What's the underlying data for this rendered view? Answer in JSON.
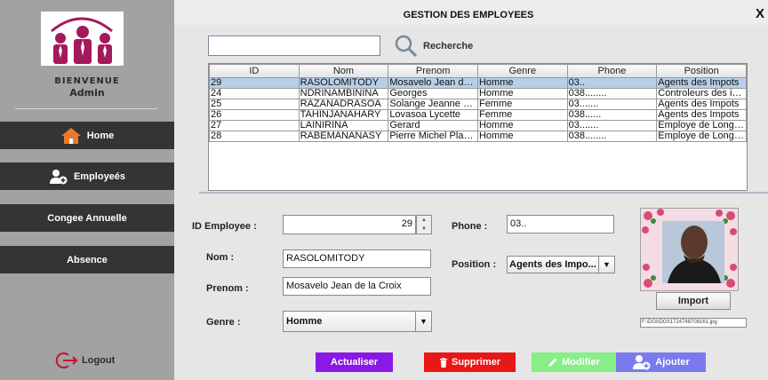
{
  "sidebar": {
    "welcome": "BIENVENUE",
    "user": "Admin",
    "nav": [
      {
        "label": "Home",
        "icon": "home-icon"
      },
      {
        "label": "Employeés",
        "icon": "add-user-icon"
      },
      {
        "label": "Congee Annuelle"
      },
      {
        "label": "Absence"
      }
    ],
    "logout": "Logout"
  },
  "header": {
    "title": "GESTION DES EMPLOYEES",
    "close": "X"
  },
  "search": {
    "value": "",
    "label": "Recherche"
  },
  "table": {
    "columns": [
      "ID",
      "Nom",
      "Prenom",
      "Genre",
      "Phone",
      "Position"
    ],
    "rows": [
      [
        "29",
        "RASOLOMITODY",
        "Mosavelo Jean de la Croix",
        "Homme",
        "03..",
        "Agents des Impots"
      ],
      [
        "24",
        "NDRINAMBININA",
        "Georges",
        "Homme",
        "038........",
        "Controleurs des impots"
      ],
      [
        "25",
        "RAZANADRASOA",
        "Solange Jeanne d'Arc",
        "Femme",
        "03.......",
        "Agents des Impots"
      ],
      [
        "26",
        "TAHINJANAHARY",
        "Lovasoa Lycette",
        "Femme",
        "038......",
        "Agents des Impots"
      ],
      [
        "27",
        "LAINIRINA",
        "Gerard",
        "Homme",
        "03.......",
        "Employe de Longue Duree"
      ],
      [
        "28",
        "RABEMANANASY",
        "Pierre Michel Placide",
        "Homme",
        "038........",
        "Employe de Longue Duree"
      ]
    ],
    "selected_row": 0
  },
  "form": {
    "id_label": "ID Employee :",
    "id_value": "29",
    "phone_label": "Phone :",
    "phone_value": "03..",
    "nom_label": "Nom :",
    "nom_value": "RASOLOMITODY",
    "position_label": "Position :",
    "position_value": "Agents des Impo...",
    "prenom_label": "Prenom :",
    "prenom_value": "Mosavelo Jean de la Croix",
    "genre_label": "Genre :",
    "genre_value": "Homme",
    "import_label": "Import",
    "photo_path": "F:\\DGI\\DGI\\1724748708161.jpg"
  },
  "actions": {
    "actualiser": "Actualiser",
    "supprimer": "Supprimer",
    "modifier": "Modifier",
    "ajouter": "Ajouter"
  },
  "colors": {
    "accent_logo": "#a3195b",
    "nav_bg": "#343434",
    "btn_actualiser": "#8a19e6",
    "btn_supprimer": "#e81818",
    "btn_modifier": "#88ee88",
    "btn_ajouter": "#7a7aee",
    "selected_row": "#b7cfe8"
  }
}
